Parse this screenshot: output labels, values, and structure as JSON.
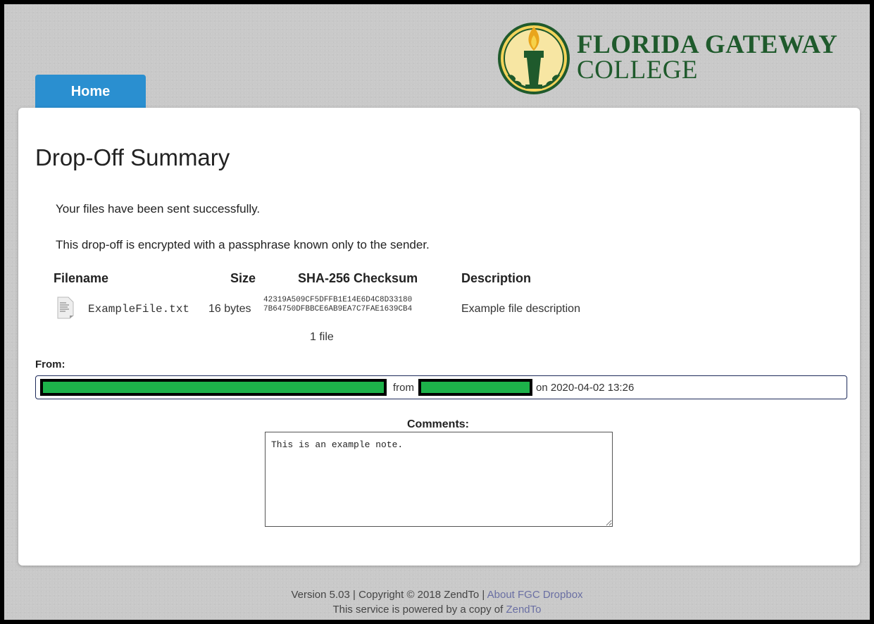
{
  "header": {
    "logo_line1": "FLORIDA GATEWAY",
    "logo_line2": "COLLEGE",
    "nav_home": "Home"
  },
  "page": {
    "title": "Drop-Off Summary",
    "message_sent": "Your files have been sent successfully.",
    "message_encrypted": "This drop-off is encrypted with a passphrase known only to the sender."
  },
  "files": {
    "headers": {
      "filename": "Filename",
      "size": "Size",
      "checksum": "SHA-256 Checksum",
      "description": "Description"
    },
    "rows": [
      {
        "icon": "text-file-icon",
        "filename": "ExampleFile.txt",
        "size": "16 bytes",
        "checksum_line1": "42319A509CF5DFFB1E14E6D4C8D33180",
        "checksum_line2": "7B64750DFBBCE6AB9EA7C7FAE1639CB4",
        "description": "Example file description"
      }
    ],
    "count": "1 file"
  },
  "from": {
    "label": "From:",
    "middle": "from",
    "date_text": "on 2020-04-02 13:26"
  },
  "comments": {
    "label": "Comments:",
    "value": "This is an example note."
  },
  "footer": {
    "version_text": "Version 5.03 | Copyright © 2018 ZendTo |",
    "about_link": "About FGC Dropbox",
    "powered_text": "This service is powered by a copy of",
    "zendto_link": "ZendTo"
  },
  "colors": {
    "tab_blue": "#2a8fd0",
    "logo_green": "#1f5a2c",
    "logo_gold": "#e9c23c",
    "redaction_green": "#1db24a"
  }
}
